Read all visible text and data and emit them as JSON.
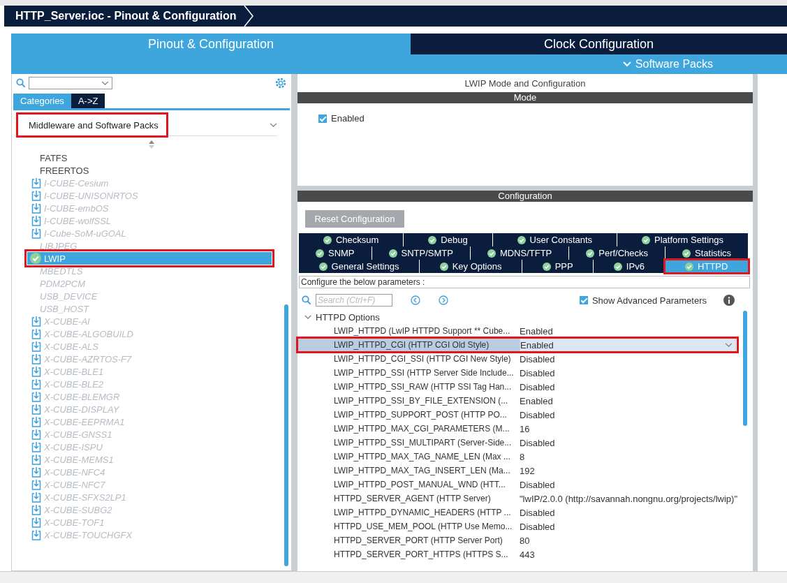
{
  "window": {
    "title": "HTTP_Server.ioc - Pinout & Configuration"
  },
  "main_tabs": [
    {
      "label": "Pinout & Configuration",
      "selected": true
    },
    {
      "label": "Clock Configuration",
      "selected": false
    }
  ],
  "software_packs": {
    "label": "Software Packs"
  },
  "left_panel": {
    "view_tabs": [
      {
        "label": "Categories",
        "selected": true
      },
      {
        "label": "A->Z",
        "selected": false
      }
    ],
    "category": {
      "value": "Middleware and Software Packs",
      "highlighted": true
    },
    "items": [
      {
        "label": "FATFS",
        "kind": "plain",
        "selected": false,
        "highlighted": false
      },
      {
        "label": "FREERTOS",
        "kind": "plain",
        "selected": false,
        "highlighted": false
      },
      {
        "label": "I-CUBE-Cesium",
        "kind": "pack",
        "selected": false,
        "highlighted": false
      },
      {
        "label": "I-CUBE-UNISONRTOS",
        "kind": "pack",
        "selected": false,
        "highlighted": false
      },
      {
        "label": "I-CUBE-embOS",
        "kind": "pack",
        "selected": false,
        "highlighted": false
      },
      {
        "label": "I-CUBE-wolfSSL",
        "kind": "pack",
        "selected": false,
        "highlighted": false
      },
      {
        "label": "I-Cube-SoM-uGOAL",
        "kind": "pack",
        "selected": false,
        "highlighted": false
      },
      {
        "label": "LIBJPEG",
        "kind": "unavailable",
        "selected": false,
        "highlighted": false
      },
      {
        "label": "LWIP",
        "kind": "enabled",
        "selected": true,
        "highlighted": true
      },
      {
        "label": "MBEDTLS",
        "kind": "unavailable",
        "selected": false,
        "highlighted": false
      },
      {
        "label": "PDM2PCM",
        "kind": "unavailable",
        "selected": false,
        "highlighted": false
      },
      {
        "label": "USB_DEVICE",
        "kind": "unavailable",
        "selected": false,
        "highlighted": false
      },
      {
        "label": "USB_HOST",
        "kind": "unavailable",
        "selected": false,
        "highlighted": false
      },
      {
        "label": "X-CUBE-AI",
        "kind": "pack",
        "selected": false,
        "highlighted": false
      },
      {
        "label": "X-CUBE-ALGOBUILD",
        "kind": "pack",
        "selected": false,
        "highlighted": false
      },
      {
        "label": "X-CUBE-ALS",
        "kind": "pack",
        "selected": false,
        "highlighted": false
      },
      {
        "label": "X-CUBE-AZRTOS-F7",
        "kind": "pack",
        "selected": false,
        "highlighted": false
      },
      {
        "label": "X-CUBE-BLE1",
        "kind": "pack",
        "selected": false,
        "highlighted": false
      },
      {
        "label": "X-CUBE-BLE2",
        "kind": "pack",
        "selected": false,
        "highlighted": false
      },
      {
        "label": "X-CUBE-BLEMGR",
        "kind": "pack",
        "selected": false,
        "highlighted": false
      },
      {
        "label": "X-CUBE-DISPLAY",
        "kind": "pack",
        "selected": false,
        "highlighted": false
      },
      {
        "label": "X-CUBE-EEPRMA1",
        "kind": "pack",
        "selected": false,
        "highlighted": false
      },
      {
        "label": "X-CUBE-GNSS1",
        "kind": "pack",
        "selected": false,
        "highlighted": false
      },
      {
        "label": "X-CUBE-ISPU",
        "kind": "pack",
        "selected": false,
        "highlighted": false
      },
      {
        "label": "X-CUBE-MEMS1",
        "kind": "pack",
        "selected": false,
        "highlighted": false
      },
      {
        "label": "X-CUBE-NFC4",
        "kind": "pack",
        "selected": false,
        "highlighted": false
      },
      {
        "label": "X-CUBE-NFC7",
        "kind": "pack",
        "selected": false,
        "highlighted": false
      },
      {
        "label": "X-CUBE-SFXS2LP1",
        "kind": "pack",
        "selected": false,
        "highlighted": false
      },
      {
        "label": "X-CUBE-SUBG2",
        "kind": "pack",
        "selected": false,
        "highlighted": false
      },
      {
        "label": "X-CUBE-TOF1",
        "kind": "pack",
        "selected": false,
        "highlighted": false
      },
      {
        "label": "X-CUBE-TOUCHGFX",
        "kind": "pack",
        "selected": false,
        "highlighted": false
      }
    ]
  },
  "mode_panel": {
    "title": "LWIP Mode and Configuration",
    "section": "Mode",
    "enabled": {
      "label": "Enabled",
      "checked": true
    }
  },
  "configuration": {
    "section": "Configuration",
    "reset_button": "Reset Configuration",
    "tab_rows": [
      [
        {
          "label": "Checksum",
          "selected": false,
          "highlighted": false
        },
        {
          "label": "Debug",
          "selected": false,
          "highlighted": false
        },
        {
          "label": "User Constants",
          "selected": false,
          "highlighted": false
        },
        {
          "label": "Platform Settings",
          "selected": false,
          "highlighted": false
        }
      ],
      [
        {
          "label": "SNMP",
          "selected": false,
          "highlighted": false
        },
        {
          "label": "SNTP/SMTP",
          "selected": false,
          "highlighted": false
        },
        {
          "label": "MDNS/TFTP",
          "selected": false,
          "highlighted": false
        },
        {
          "label": "Perf/Checks",
          "selected": false,
          "highlighted": false
        },
        {
          "label": "Statistics",
          "selected": false,
          "highlighted": false
        }
      ],
      [
        {
          "label": "General Settings",
          "selected": false,
          "highlighted": false
        },
        {
          "label": "Key Options",
          "selected": false,
          "highlighted": false
        },
        {
          "label": "PPP",
          "selected": false,
          "highlighted": false
        },
        {
          "label": "IPv6",
          "selected": false,
          "highlighted": false
        },
        {
          "label": "HTTPD",
          "selected": true,
          "highlighted": true
        }
      ]
    ],
    "hint": "Configure the below parameters :",
    "search": {
      "placeholder": "Search (Ctrl+F)"
    },
    "show_advanced": {
      "label": "Show Advanced Parameters",
      "checked": true
    },
    "group": {
      "label": "HTTPD Options",
      "expanded": true
    },
    "parameters": [
      {
        "name": "LWIP_HTTPD (LwIP HTTPD Support ** Cube...",
        "value": "Enabled",
        "selected": false,
        "highlighted": false
      },
      {
        "name": "LWIP_HTTPD_CGI (HTTP CGI Old Style)",
        "value": "Enabled",
        "selected": true,
        "highlighted": true
      },
      {
        "name": "LWIP_HTTPD_CGI_SSI (HTTP CGI New Style)",
        "value": "Disabled",
        "selected": false,
        "highlighted": false
      },
      {
        "name": "LWIP_HTTPD_SSI (HTTP Server Side Include...",
        "value": "Disabled",
        "selected": false,
        "highlighted": false
      },
      {
        "name": "LWIP_HTTPD_SSI_RAW (HTTP SSI Tag Han...",
        "value": "Disabled",
        "selected": false,
        "highlighted": false
      },
      {
        "name": "LWIP_HTTPD_SSI_BY_FILE_EXTENSION (...",
        "value": "Enabled",
        "selected": false,
        "highlighted": false
      },
      {
        "name": "LWIP_HTTPD_SUPPORT_POST (HTTP PO...",
        "value": "Disabled",
        "selected": false,
        "highlighted": false
      },
      {
        "name": "LWIP_HTTPD_MAX_CGI_PARAMETERS (M...",
        "value": "16",
        "selected": false,
        "highlighted": false
      },
      {
        "name": "LWIP_HTTPD_SSI_MULTIPART (Server-Side...",
        "value": "Disabled",
        "selected": false,
        "highlighted": false
      },
      {
        "name": "LWIP_HTTPD_MAX_TAG_NAME_LEN (Max ...",
        "value": "8",
        "selected": false,
        "highlighted": false
      },
      {
        "name": "LWIP_HTTPD_MAX_TAG_INSERT_LEN (Ma...",
        "value": "192",
        "selected": false,
        "highlighted": false
      },
      {
        "name": "LWIP_HTTPD_POST_MANUAL_WND (HTT...",
        "value": "Disabled",
        "selected": false,
        "highlighted": false
      },
      {
        "name": "HTTPD_SERVER_AGENT (HTTP Server)",
        "value": "\"lwIP/2.0.0 (http://savannah.nongnu.org/projects/lwip)\"",
        "selected": false,
        "highlighted": false
      },
      {
        "name": "LWIP_HTTPD_DYNAMIC_HEADERS (HTTP ...",
        "value": "Disabled",
        "selected": false,
        "highlighted": false
      },
      {
        "name": "HTTPD_USE_MEM_POOL (HTTP Use Memo...",
        "value": "Disabled",
        "selected": false,
        "highlighted": false
      },
      {
        "name": "HTTPD_SERVER_PORT (HTTP Server Port)",
        "value": "80",
        "selected": false,
        "highlighted": false
      },
      {
        "name": "HTTPD_SERVER_PORT_HTTPS (HTTPS S...",
        "value": "443",
        "selected": false,
        "highlighted": false
      }
    ]
  }
}
